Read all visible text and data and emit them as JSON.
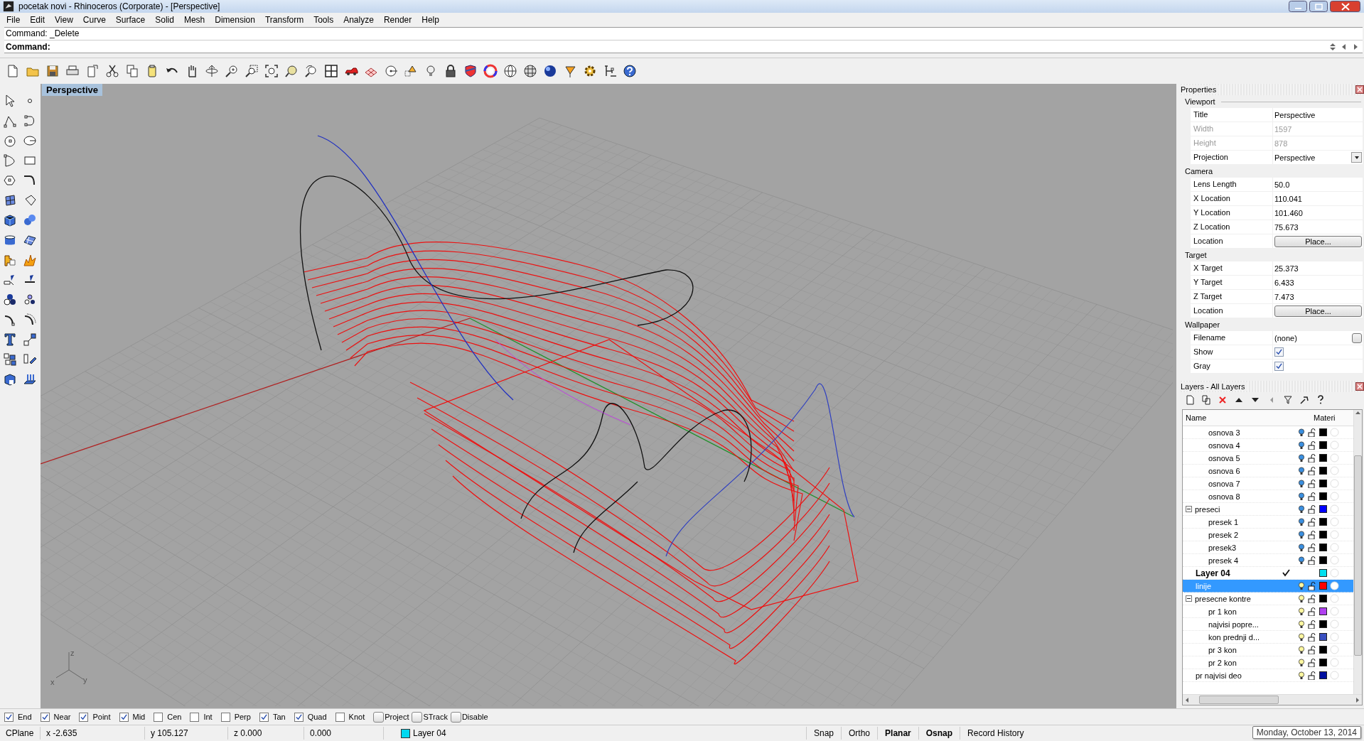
{
  "window": {
    "title": "pocetak novi - Rhinoceros (Corporate) - [Perspective]"
  },
  "menu": [
    "File",
    "Edit",
    "View",
    "Curve",
    "Surface",
    "Solid",
    "Mesh",
    "Dimension",
    "Transform",
    "Tools",
    "Analyze",
    "Render",
    "Help"
  ],
  "command": {
    "history": "Command: _Delete",
    "prompt": "Command:"
  },
  "viewport": {
    "title": "Perspective",
    "axis_labels": {
      "x": "x",
      "y": "y",
      "z": "z"
    }
  },
  "properties": {
    "title": "Properties",
    "sections": [
      {
        "title": "Viewport",
        "rows": [
          {
            "kind": "text",
            "label": "Title",
            "value": "Perspective"
          },
          {
            "kind": "disabled",
            "label": "Width",
            "value": "1597"
          },
          {
            "kind": "disabled",
            "label": "Height",
            "value": "878"
          },
          {
            "kind": "dropdown",
            "label": "Projection",
            "value": "Perspective"
          }
        ]
      },
      {
        "title": "Camera",
        "rows": [
          {
            "kind": "text",
            "label": "Lens Length",
            "value": "50.0"
          },
          {
            "kind": "text",
            "label": "X Location",
            "value": "110.041"
          },
          {
            "kind": "text",
            "label": "Y Location",
            "value": "101.460"
          },
          {
            "kind": "text",
            "label": "Z Location",
            "value": "75.673"
          },
          {
            "kind": "button",
            "label": "Location",
            "value": "Place..."
          }
        ]
      },
      {
        "title": "Target",
        "rows": [
          {
            "kind": "text",
            "label": "X Target",
            "value": "25.373"
          },
          {
            "kind": "text",
            "label": "Y Target",
            "value": "6.433"
          },
          {
            "kind": "text",
            "label": "Z Target",
            "value": "7.473"
          },
          {
            "kind": "button",
            "label": "Location",
            "value": "Place..."
          }
        ]
      },
      {
        "title": "Wallpaper",
        "rows": [
          {
            "kind": "browse",
            "label": "Filename",
            "value": "(none)"
          },
          {
            "kind": "checkbox",
            "label": "Show",
            "checked": true
          },
          {
            "kind": "checkbox",
            "label": "Gray",
            "checked": true
          }
        ]
      }
    ]
  },
  "layers": {
    "title": "Layers - All Layers",
    "columns": [
      "Name",
      "Materi"
    ],
    "rows": [
      {
        "children": [
          {
            "name": "osnova 3",
            "current": false,
            "selected": false,
            "lit": false,
            "color": "#000000"
          },
          {
            "name": "osnova 4",
            "current": false,
            "selected": false,
            "lit": false,
            "color": "#000000"
          },
          {
            "name": "osnova 5",
            "current": false,
            "selected": false,
            "lit": false,
            "color": "#000000"
          },
          {
            "name": "osnova 6",
            "current": false,
            "selected": false,
            "lit": false,
            "color": "#000000"
          },
          {
            "name": "osnova 7",
            "current": false,
            "selected": false,
            "lit": false,
            "color": "#000000"
          },
          {
            "name": "osnova 8",
            "current": false,
            "selected": false,
            "lit": false,
            "color": "#000000"
          }
        ]
      },
      {
        "name": "preseci",
        "current": false,
        "selected": false,
        "expanded": true,
        "lit": false,
        "color": "#0000ff",
        "children": [
          {
            "name": "presek 1",
            "current": false,
            "selected": false,
            "lit": false,
            "color": "#000000"
          },
          {
            "name": "presek 2",
            "current": false,
            "selected": false,
            "lit": false,
            "color": "#000000"
          },
          {
            "name": "presek3",
            "current": false,
            "selected": false,
            "lit": false,
            "color": "#000000"
          },
          {
            "name": "presek 4",
            "current": false,
            "selected": false,
            "lit": false,
            "color": "#000000"
          }
        ]
      },
      {
        "name": "Layer 04",
        "current": true,
        "selected": false,
        "color": "#00e0f0"
      },
      {
        "name": "linije",
        "current": false,
        "selected": true,
        "lit": true,
        "color": "#ff0000"
      },
      {
        "name": "presecne kontre",
        "current": false,
        "selected": false,
        "expanded": true,
        "lit": true,
        "color": "#000000",
        "children": [
          {
            "name": "pr 1 kon",
            "current": false,
            "selected": false,
            "lit": true,
            "color": "#b040f0"
          },
          {
            "name": "najvisi popre...",
            "current": false,
            "selected": false,
            "lit": true,
            "color": "#000000"
          },
          {
            "name": "kon prednji d...",
            "current": false,
            "selected": false,
            "lit": true,
            "color": "#3a50c0"
          },
          {
            "name": "pr 3 kon",
            "current": false,
            "selected": false,
            "lit": true,
            "color": "#000000"
          },
          {
            "name": "pr 2 kon",
            "current": false,
            "selected": false,
            "lit": true,
            "color": "#000000"
          }
        ]
      },
      {
        "name": "pr najvisi deo",
        "current": false,
        "selected": false,
        "lit": true,
        "color": "#0010a0"
      }
    ]
  },
  "osnaps": [
    {
      "kind": "check",
      "label": "End",
      "checked": true
    },
    {
      "kind": "check",
      "label": "Near",
      "checked": true
    },
    {
      "kind": "check",
      "label": "Point",
      "checked": true
    },
    {
      "kind": "check",
      "label": "Mid",
      "checked": true
    },
    {
      "kind": "check",
      "label": "Cen",
      "checked": false
    },
    {
      "kind": "check",
      "label": "Int",
      "checked": false
    },
    {
      "kind": "check",
      "label": "Perp",
      "checked": false
    },
    {
      "kind": "check",
      "label": "Tan",
      "checked": true
    },
    {
      "kind": "check",
      "label": "Quad",
      "checked": true
    },
    {
      "kind": "check",
      "label": "Knot",
      "checked": false
    },
    {
      "kind": "toggle",
      "label": "Project",
      "checked": false
    },
    {
      "kind": "toggle",
      "label": "STrack",
      "checked": false
    },
    {
      "kind": "toggle",
      "label": "Disable",
      "checked": false
    }
  ],
  "status": {
    "cplane": "CPlane",
    "x": "x -2.635",
    "y": "y 105.127",
    "z": "z 0.000",
    "distance": "0.000",
    "layer": {
      "name": "Layer 04",
      "color": "#00d8f0"
    },
    "toggles": [
      {
        "label": "Snap",
        "on": false
      },
      {
        "label": "Ortho",
        "on": false
      },
      {
        "label": "Planar",
        "on": true
      },
      {
        "label": "Osnap",
        "on": true
      },
      {
        "label": "Record History",
        "on": false
      }
    ],
    "date": "Monday, October 13, 2014"
  }
}
